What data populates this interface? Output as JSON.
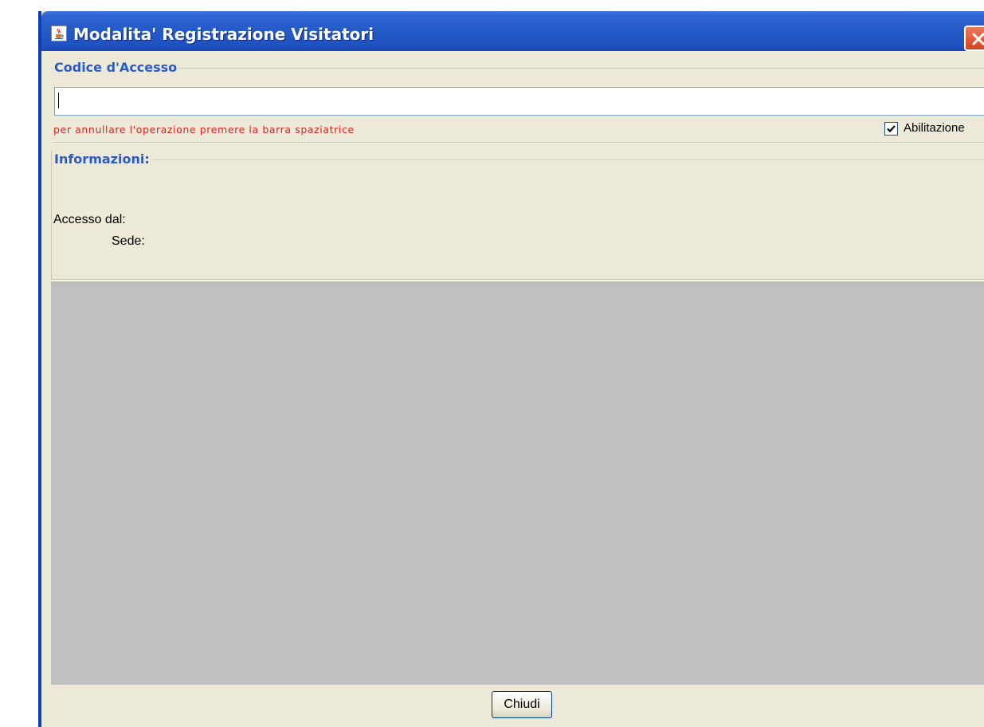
{
  "window": {
    "title": "Modalita' Registrazione Visitatori",
    "icon": "java-cup-icon",
    "close_icon": "close-icon"
  },
  "access_code_group": {
    "title": "Codice d'Accesso",
    "input_value": "",
    "hint": "per annullare l'operazione premere la barra spaziatrice",
    "checkbox_label": "Abilitazione",
    "checkbox_checked": true
  },
  "info_group": {
    "title": "Informazioni:",
    "accesso_label": "Accesso dal:",
    "sede_label": "Sede:"
  },
  "footer": {
    "close_label": "Chiudi"
  },
  "colors": {
    "titlebar": "#2459c8",
    "group_title": "#2b5ac9",
    "hint": "#e0201e",
    "panel": "#ECE9D8",
    "gray_area": "#c0c0c0"
  }
}
